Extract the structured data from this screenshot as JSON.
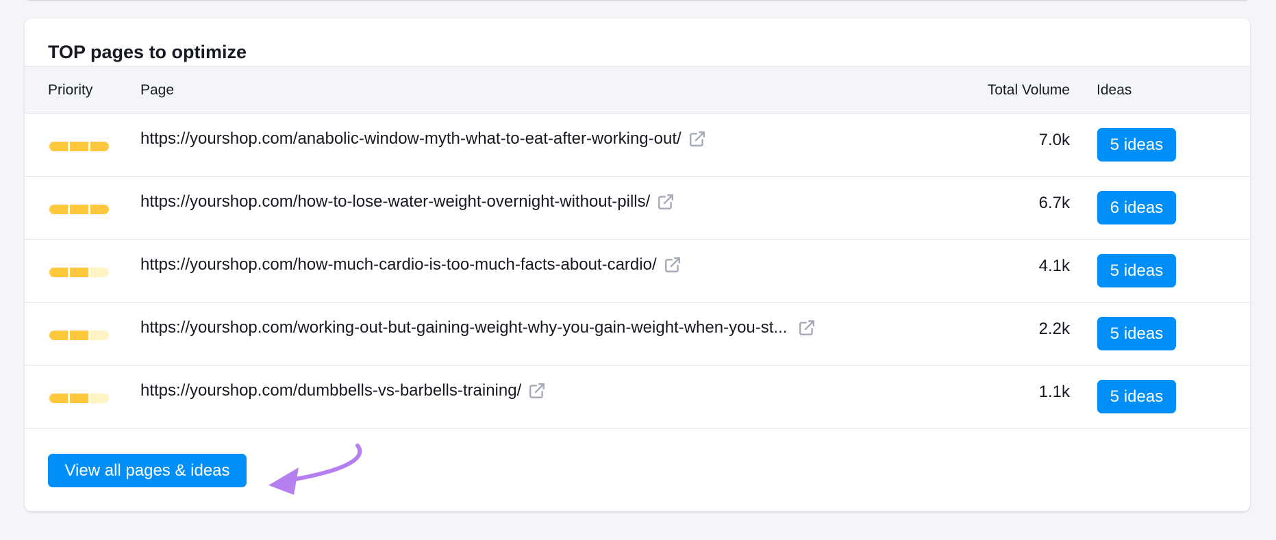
{
  "panel": {
    "title": "TOP pages to optimize"
  },
  "table": {
    "columns": {
      "priority": "Priority",
      "page": "Page",
      "volume": "Total Volume",
      "ideas": "Ideas"
    },
    "rows": [
      {
        "priority_level": 3,
        "priority_max": 3,
        "url": "https://yourshop.com/anabolic-window-myth-what-to-eat-after-working-out/",
        "volume": "7.0k",
        "ideas": "5 ideas"
      },
      {
        "priority_level": 3,
        "priority_max": 3,
        "url": "https://yourshop.com/how-to-lose-water-weight-overnight-without-pills/",
        "volume": "6.7k",
        "ideas": "6 ideas"
      },
      {
        "priority_level": 2,
        "priority_max": 3,
        "url": "https://yourshop.com/how-much-cardio-is-too-much-facts-about-cardio/",
        "volume": "4.1k",
        "ideas": "5 ideas"
      },
      {
        "priority_level": 2,
        "priority_max": 3,
        "url": "https://yourshop.com/working-out-but-gaining-weight-why-you-gain-weight-when-you-st...",
        "volume": "2.2k",
        "ideas": "5 ideas"
      },
      {
        "priority_level": 2,
        "priority_max": 3,
        "url": "https://yourshop.com/dumbbells-vs-barbells-training/",
        "volume": "1.1k",
        "ideas": "5 ideas"
      }
    ]
  },
  "footer": {
    "view_all_label": "View all pages & ideas"
  },
  "icons": {
    "external_link": "external-link-icon",
    "annotation": "purple-arrow-annotation"
  },
  "colors": {
    "accent": "#008ff8",
    "priority_on": "#ffc73e",
    "priority_off": "#fff3c4",
    "annotation_arrow": "#b57ff0",
    "icon_gray": "#a6aab7"
  }
}
